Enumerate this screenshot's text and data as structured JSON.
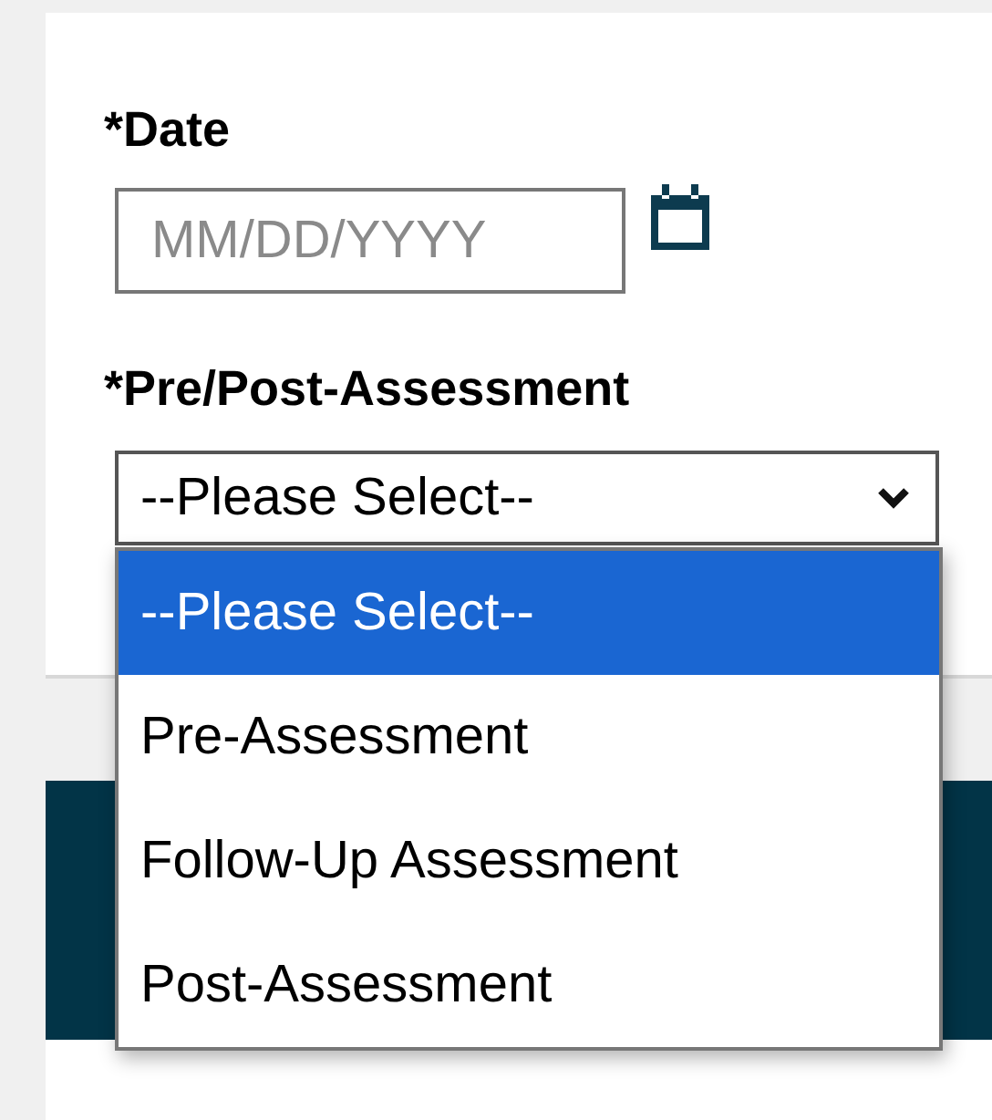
{
  "date_field": {
    "label": "*Date",
    "placeholder": "MM/DD/YYYY"
  },
  "assessment_field": {
    "label": "*Pre/Post-Assessment",
    "value": "--Please Select--",
    "expanded": true,
    "options": [
      {
        "label": "--Please Select--",
        "selected": true
      },
      {
        "label": "Pre-Assessment",
        "selected": false
      },
      {
        "label": "Follow-Up Assessment",
        "selected": false
      },
      {
        "label": "Post-Assessment",
        "selected": false
      }
    ]
  }
}
